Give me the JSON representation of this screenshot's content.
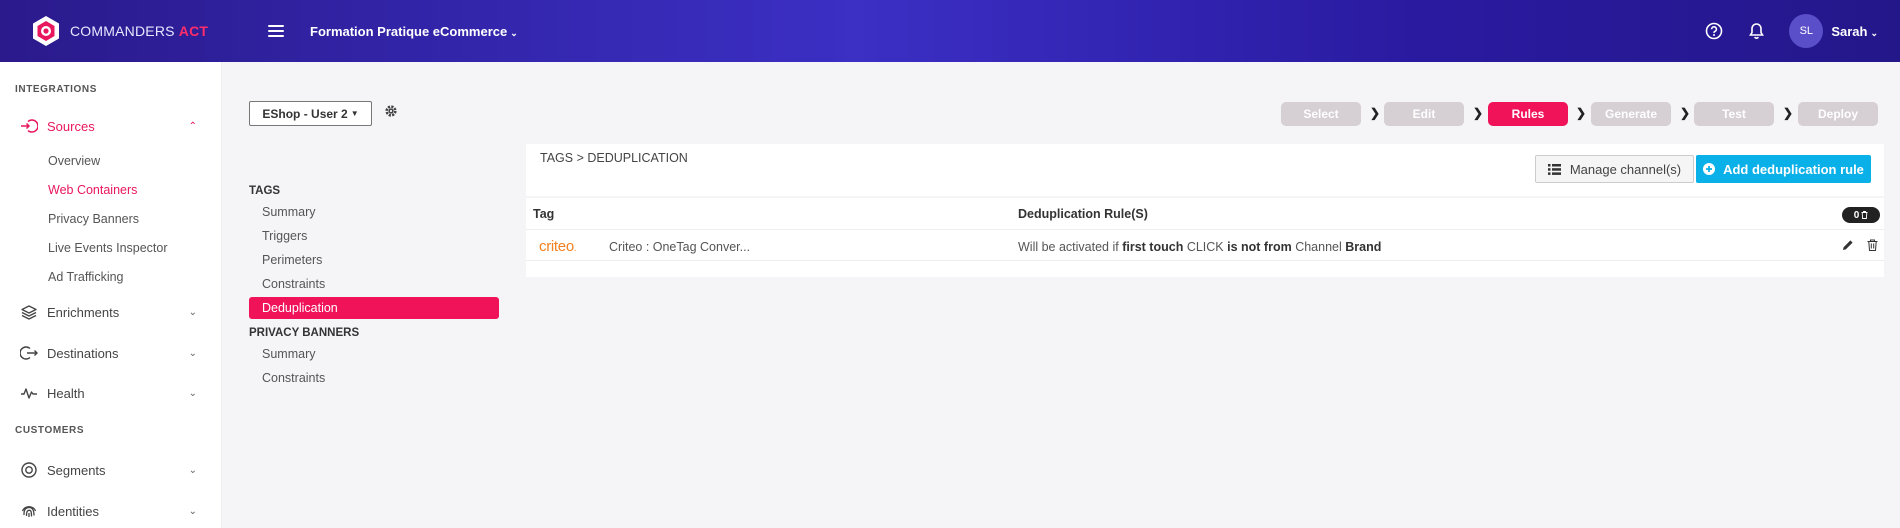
{
  "topbar": {
    "logo_text": "COMMANDERS",
    "logo_accent": "ACT",
    "workspace": "Formation Pratique eCommerce",
    "user_initials": "SL",
    "user_name": "Sarah"
  },
  "sidebar": {
    "sections": [
      "INTEGRATIONS",
      "CUSTOMERS"
    ],
    "items": [
      {
        "label": "Sources",
        "icon": "sources-icon"
      },
      {
        "label": "Enrichments",
        "icon": "layers-icon"
      },
      {
        "label": "Destinations",
        "icon": "destinations-icon"
      },
      {
        "label": "Health",
        "icon": "pulse-icon"
      },
      {
        "label": "Segments",
        "icon": "segments-icon"
      },
      {
        "label": "Identities",
        "icon": "fingerprint-icon"
      }
    ],
    "sources_sub": [
      "Overview",
      "Web Containers",
      "Privacy Banners",
      "Live Events Inspector",
      "Ad Trafficking"
    ]
  },
  "container": {
    "selected": "EShop - User 2"
  },
  "steps": [
    "Select",
    "Edit",
    "Rules",
    "Generate",
    "Test",
    "Deploy"
  ],
  "nav": {
    "tags_heading": "TAGS",
    "tags_items": [
      "Summary",
      "Triggers",
      "Perimeters",
      "Constraints",
      "Deduplication"
    ],
    "privacy_heading": "PRIVACY BANNERS",
    "privacy_items": [
      "Summary",
      "Constraints"
    ]
  },
  "panel": {
    "breadcrumb": "TAGS > DEDUPLICATION",
    "manage_label": "Manage channel(s)",
    "add_label": "Add deduplication rule"
  },
  "table": {
    "col_tag": "Tag",
    "col_rule": "Deduplication Rule(S)",
    "count": "0",
    "rows": [
      {
        "logo": "criteo",
        "tag": "Criteo : OneTag Conver...",
        "rule_prefix": "Will be activated if",
        "rule_b1": "first touch",
        "rule_mid1": "CLICK",
        "rule_b2": "is not from",
        "rule_mid2": "Channel",
        "rule_b3": "Brand"
      }
    ]
  },
  "colors": {
    "accent": "#f0135a",
    "primary_button": "#0ab0e8",
    "topbar": "#2a1a8c"
  }
}
